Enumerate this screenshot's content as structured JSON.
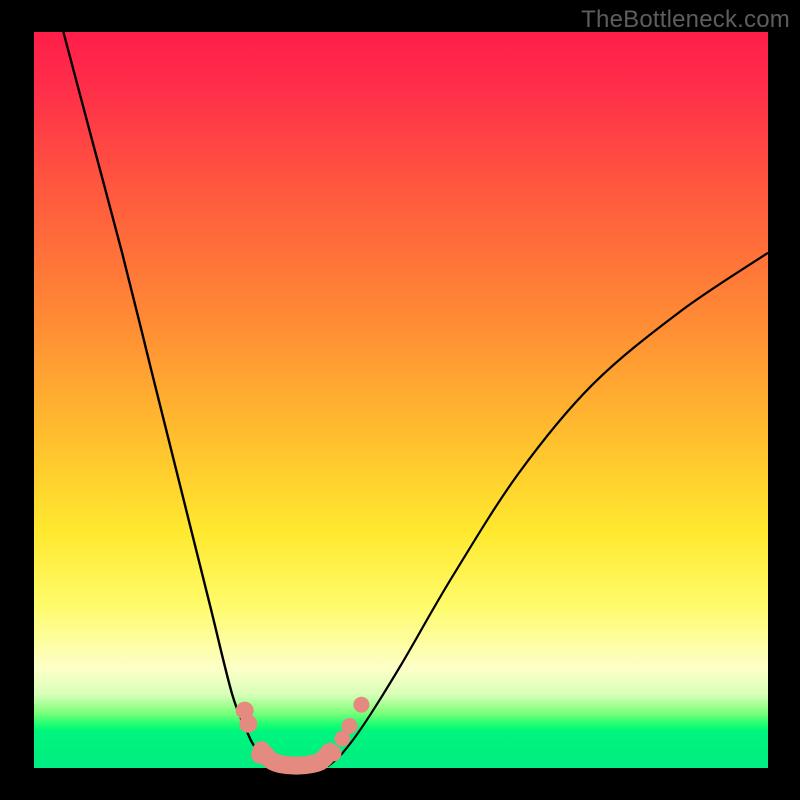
{
  "watermark": "TheBottleneck.com",
  "chart_data": {
    "type": "line",
    "title": "",
    "xlabel": "",
    "ylabel": "",
    "xlim": [
      0,
      100
    ],
    "ylim": [
      0,
      100
    ],
    "grid": false,
    "series": [
      {
        "name": "left-curve",
        "x": [
          4,
          8,
          12,
          16,
          20,
          24,
          27,
          29,
          30,
          31.5,
          33
        ],
        "y": [
          100,
          85,
          70,
          54,
          38,
          22,
          10,
          5,
          3,
          1.2,
          0.2
        ]
      },
      {
        "name": "right-curve",
        "x": [
          40,
          42,
          45,
          50,
          57,
          66,
          76,
          88,
          100
        ],
        "y": [
          0.2,
          2,
          6,
          14,
          26,
          40,
          52,
          62,
          70
        ]
      }
    ],
    "markers_left": [
      {
        "x": 28.7,
        "y": 7.8
      },
      {
        "x": 29.2,
        "y": 6.0
      },
      {
        "x": 30.8,
        "y": 1.8
      }
    ],
    "markers_right": [
      {
        "x": 40.8,
        "y": 2.0
      },
      {
        "x": 42.0,
        "y": 4.0
      },
      {
        "x": 43.0,
        "y": 5.7
      },
      {
        "x": 44.6,
        "y": 8.6
      }
    ],
    "valley_segment": {
      "x": [
        31.0,
        32.5,
        34.5,
        37.0,
        39.0,
        40.3
      ],
      "y": [
        2.4,
        0.9,
        0.4,
        0.4,
        0.9,
        2.2
      ]
    },
    "gradient_stops": [
      {
        "pos": 0,
        "color": "#ff1e4a"
      },
      {
        "pos": 40,
        "color": "#ff8d34"
      },
      {
        "pos": 68,
        "color": "#ffe92f"
      },
      {
        "pos": 88,
        "color": "#fdffc9"
      },
      {
        "pos": 94,
        "color": "#16ff72"
      },
      {
        "pos": 100,
        "color": "#00ed82"
      }
    ]
  }
}
